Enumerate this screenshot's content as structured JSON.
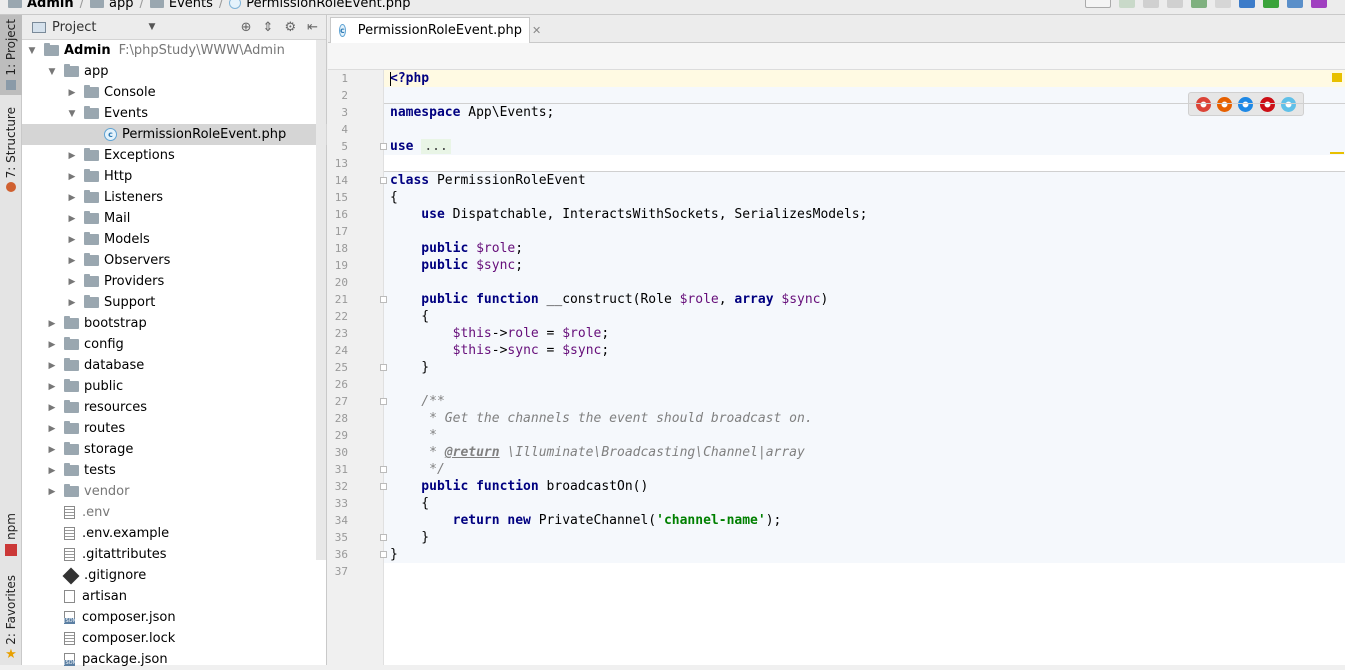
{
  "breadcrumbs": [
    {
      "label": "Admin",
      "type": "folder",
      "bold": true
    },
    {
      "label": "app",
      "type": "folder"
    },
    {
      "label": "Events",
      "type": "folder"
    },
    {
      "label": "PermissionRoleEvent.php",
      "type": "class"
    }
  ],
  "side_tabs": {
    "project": "1: Project",
    "structure": "7: Structure",
    "npm": "npm",
    "favorites": "2: Favorites"
  },
  "project_panel": {
    "title": "Project",
    "tree": [
      {
        "label": "Admin",
        "path": "F:\\phpStudy\\WWW\\Admin",
        "kind": "folder",
        "depth": 0,
        "expanded": true,
        "bold": true
      },
      {
        "label": "app",
        "kind": "folder",
        "depth": 1,
        "expanded": true
      },
      {
        "label": "Console",
        "kind": "folder",
        "depth": 2,
        "expanded": false
      },
      {
        "label": "Events",
        "kind": "folder",
        "depth": 2,
        "expanded": true
      },
      {
        "label": "PermissionRoleEvent.php",
        "kind": "class",
        "depth": 3,
        "selected": true
      },
      {
        "label": "Exceptions",
        "kind": "folder",
        "depth": 2,
        "expanded": false
      },
      {
        "label": "Http",
        "kind": "folder",
        "depth": 2,
        "expanded": false
      },
      {
        "label": "Listeners",
        "kind": "folder",
        "depth": 2,
        "expanded": false
      },
      {
        "label": "Mail",
        "kind": "folder",
        "depth": 2,
        "expanded": false
      },
      {
        "label": "Models",
        "kind": "folder",
        "depth": 2,
        "expanded": false
      },
      {
        "label": "Observers",
        "kind": "folder",
        "depth": 2,
        "expanded": false
      },
      {
        "label": "Providers",
        "kind": "folder",
        "depth": 2,
        "expanded": false
      },
      {
        "label": "Support",
        "kind": "folder",
        "depth": 2,
        "expanded": false
      },
      {
        "label": "bootstrap",
        "kind": "folder",
        "depth": 1,
        "expanded": false
      },
      {
        "label": "config",
        "kind": "folder",
        "depth": 1,
        "expanded": false
      },
      {
        "label": "database",
        "kind": "folder",
        "depth": 1,
        "expanded": false
      },
      {
        "label": "public",
        "kind": "folder",
        "depth": 1,
        "expanded": false
      },
      {
        "label": "resources",
        "kind": "folder",
        "depth": 1,
        "expanded": false
      },
      {
        "label": "routes",
        "kind": "folder",
        "depth": 1,
        "expanded": false
      },
      {
        "label": "storage",
        "kind": "folder",
        "depth": 1,
        "expanded": false
      },
      {
        "label": "tests",
        "kind": "folder",
        "depth": 1,
        "expanded": false
      },
      {
        "label": "vendor",
        "kind": "folder",
        "depth": 1,
        "expanded": false,
        "dim": true
      },
      {
        "label": ".env",
        "kind": "file-lines",
        "depth": 1,
        "dim": true
      },
      {
        "label": ".env.example",
        "kind": "file-lines",
        "depth": 1
      },
      {
        "label": ".gitattributes",
        "kind": "file-lines",
        "depth": 1
      },
      {
        "label": ".gitignore",
        "kind": "git",
        "depth": 1
      },
      {
        "label": "artisan",
        "kind": "file",
        "depth": 1
      },
      {
        "label": "composer.json",
        "kind": "json",
        "depth": 1
      },
      {
        "label": "composer.lock",
        "kind": "file-lines",
        "depth": 1
      },
      {
        "label": "package.json",
        "kind": "json",
        "depth": 1
      }
    ]
  },
  "editor": {
    "tab_label": "PermissionRoleEvent.php",
    "lines": [
      {
        "n": "1",
        "parts": [
          [
            "<?php",
            "kw"
          ]
        ],
        "current": true
      },
      {
        "n": "2",
        "parts": []
      },
      {
        "n": "3",
        "parts": [
          [
            "namespace ",
            "kw"
          ],
          [
            "App\\Events;",
            ""
          ]
        ]
      },
      {
        "n": "4",
        "parts": []
      },
      {
        "n": "5",
        "parts": [
          [
            "use ",
            "kw"
          ],
          [
            "...",
            "fold"
          ]
        ],
        "fold": true
      },
      {
        "n": "13",
        "parts": []
      },
      {
        "n": "14",
        "parts": [
          [
            "class ",
            "kw"
          ],
          [
            "PermissionRoleEvent",
            ""
          ]
        ],
        "fold": true
      },
      {
        "n": "15",
        "parts": [
          [
            "{",
            ""
          ]
        ]
      },
      {
        "n": "16",
        "parts": [
          [
            "    use ",
            "kw"
          ],
          [
            "Dispatchable, InteractsWithSockets, SerializesModels;",
            ""
          ]
        ]
      },
      {
        "n": "17",
        "parts": []
      },
      {
        "n": "18",
        "parts": [
          [
            "    public ",
            "kw"
          ],
          [
            "$role",
            "var"
          ],
          [
            ";",
            ""
          ]
        ]
      },
      {
        "n": "19",
        "parts": [
          [
            "    public ",
            "kw"
          ],
          [
            "$sync",
            "var"
          ],
          [
            ";",
            ""
          ]
        ]
      },
      {
        "n": "20",
        "parts": []
      },
      {
        "n": "21",
        "parts": [
          [
            "    public function ",
            "kw"
          ],
          [
            "__construct(Role ",
            ""
          ],
          [
            "$role",
            "var"
          ],
          [
            ", ",
            ""
          ],
          [
            "array ",
            "kw"
          ],
          [
            "$sync",
            "var"
          ],
          [
            ")",
            ""
          ]
        ],
        "fold": true
      },
      {
        "n": "22",
        "parts": [
          [
            "    {",
            ""
          ]
        ]
      },
      {
        "n": "23",
        "parts": [
          [
            "        ",
            ""
          ],
          [
            "$this",
            "var"
          ],
          [
            "->",
            ""
          ],
          [
            "role",
            "var"
          ],
          [
            " = ",
            ""
          ],
          [
            "$role",
            "var"
          ],
          [
            ";",
            ""
          ]
        ]
      },
      {
        "n": "24",
        "parts": [
          [
            "        ",
            ""
          ],
          [
            "$this",
            "var"
          ],
          [
            "->",
            ""
          ],
          [
            "sync",
            "var"
          ],
          [
            " = ",
            ""
          ],
          [
            "$sync",
            "var"
          ],
          [
            ";",
            ""
          ]
        ]
      },
      {
        "n": "25",
        "parts": [
          [
            "    }",
            ""
          ]
        ],
        "fold": true
      },
      {
        "n": "26",
        "parts": []
      },
      {
        "n": "27",
        "parts": [
          [
            "    /**",
            "cm"
          ]
        ],
        "fold": true
      },
      {
        "n": "28",
        "parts": [
          [
            "     * Get the channels the event should broadcast on.",
            "cm"
          ]
        ]
      },
      {
        "n": "29",
        "parts": [
          [
            "     *",
            "cm"
          ]
        ]
      },
      {
        "n": "30",
        "parts": [
          [
            "     * ",
            "cm"
          ],
          [
            "@return",
            "doctag"
          ],
          [
            " \\Illuminate\\Broadcasting\\Channel|array",
            "cm"
          ]
        ]
      },
      {
        "n": "31",
        "parts": [
          [
            "     */",
            "cm"
          ]
        ],
        "fold": true
      },
      {
        "n": "32",
        "parts": [
          [
            "    public function ",
            "kw"
          ],
          [
            "broadcastOn()",
            ""
          ]
        ],
        "fold": true
      },
      {
        "n": "33",
        "parts": [
          [
            "    {",
            ""
          ]
        ]
      },
      {
        "n": "34",
        "parts": [
          [
            "        return new ",
            "kw"
          ],
          [
            "PrivateChannel(",
            ""
          ],
          [
            "'channel-name'",
            "str"
          ],
          [
            ");",
            ""
          ]
        ]
      },
      {
        "n": "35",
        "parts": [
          [
            "    }",
            ""
          ]
        ],
        "fold": true
      },
      {
        "n": "36",
        "parts": [
          [
            "}",
            ""
          ]
        ],
        "fold": true
      },
      {
        "n": "37",
        "parts": []
      }
    ]
  },
  "browser_icons": [
    {
      "name": "chrome-icon",
      "color": "#db4437"
    },
    {
      "name": "firefox-icon",
      "color": "#e66000"
    },
    {
      "name": "safari-icon",
      "color": "#1e88e5"
    },
    {
      "name": "opera-icon",
      "color": "#cc0f16"
    },
    {
      "name": "ie-icon",
      "color": "#60c0e8"
    }
  ],
  "colors": {
    "keyword": "#000080",
    "variable": "#660e7a",
    "string": "#008000",
    "comment": "#808080",
    "class_block_bg": "#f5f8fc",
    "current_line_bg": "#fffae3"
  }
}
